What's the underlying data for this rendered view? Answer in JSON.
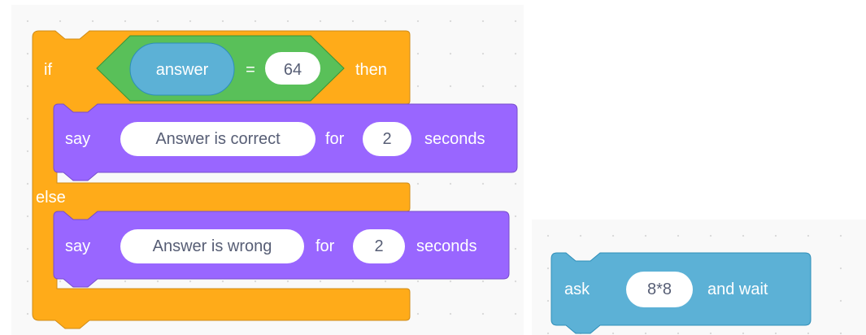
{
  "colors": {
    "control": "#ffab19",
    "control_dark": "#cf8b17",
    "operator": "#59c059",
    "operator_dark": "#389438",
    "sensing": "#5cb1d6",
    "sensing_dark": "#2e8eb8",
    "looks": "#9966ff",
    "looks_dark": "#774dcb",
    "input_bg": "#ffffff",
    "input_text": "#575e75"
  },
  "if_else_block": {
    "if_label": "if",
    "then_label": "then",
    "else_label": "else",
    "condition": {
      "reporter": "answer",
      "operator": "=",
      "value": "64"
    }
  },
  "say_correct": {
    "say_label": "say",
    "message": "Answer is correct",
    "for_label": "for",
    "secs": "2",
    "seconds_label": "seconds"
  },
  "say_wrong": {
    "say_label": "say",
    "message": "Answer is wrong",
    "for_label": "for",
    "secs": "2",
    "seconds_label": "seconds"
  },
  "ask_block": {
    "ask_label": "ask",
    "question": "8*8",
    "wait_label": "and wait"
  }
}
